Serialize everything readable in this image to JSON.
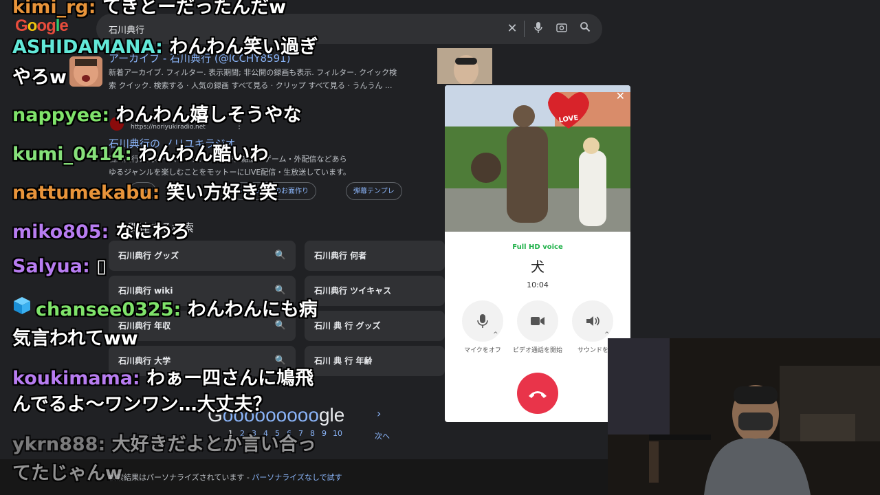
{
  "google": {
    "logo_letters": [
      "G",
      "o",
      "o",
      "g",
      "l",
      "e"
    ],
    "search_query": "石川典行",
    "result1": {
      "title": "アーカイブ - 石川典行 (@ICCHY8591)",
      "snippet_line1": "新着アーカイブ. フィルター. 表示期間; 非公開の録画も表示. フィルター. クイック検",
      "snippet_line2": "索 クイック. 検索する · 人気の録画 すべて見る · クリップ すべて見る · うんうん ..."
    },
    "result2": {
      "url": "https://noriyukiradio.net",
      "title": "石川典行の ノリユキラジオ",
      "snippet_line1": "石川典行公式ホームページ. ノリラジ。雑談・ゲーム・外配信などあら",
      "snippet_line2": "ゆるジャンルを楽しむことをモットーにLIVE配信・生放送しています。"
    },
    "chips": [
      "ishi",
      "ハロウィンのお面作り",
      "弾幕テンプレ"
    ],
    "related_heading": "関連する検索",
    "related": [
      "石川典行 グッズ",
      "石川典行 何者",
      "石川典行 wiki",
      "石川典行 ツイキャス",
      "石川典行 年収",
      "石川 典 行 グッズ",
      "石川典行 大学",
      "石川 典 行 年齢"
    ],
    "pagination_logo": {
      "prefix": "G",
      "repeat": "ooooooooo",
      "suffix": "gle"
    },
    "pages": [
      "1",
      "2",
      "3",
      "4",
      "5",
      "6",
      "7",
      "8",
      "9",
      "10"
    ],
    "next_label": "次へ",
    "footer_text": "検索結果はパーソナライズされています - ",
    "footer_link": "パーソナライズなしで試す"
  },
  "chat": [
    {
      "user": "kimi_rg",
      "sep": ": ",
      "msg": "てきとーだったんだw",
      "color": "orange"
    },
    {
      "user": "ASHIDAMANA",
      "sep": ": ",
      "msg": "わんわん笑い過ぎ",
      "color": "cyan"
    },
    {
      "user": "",
      "sep": "",
      "msg": "やろw",
      "color": "orange"
    },
    {
      "user": "nappyee",
      "sep": ": ",
      "msg": "わんわん嬉しそうやな",
      "color": "lgreen"
    },
    {
      "user": "kumi_0414",
      "sep": ": ",
      "msg": "わんわん酷いわ",
      "color": "green"
    },
    {
      "user": "nattumekabu",
      "sep": ": ",
      "msg": "笑い方好き笑",
      "color": "orange"
    },
    {
      "user": "miko805",
      "sep": ": ",
      "msg": "なにわろ",
      "color": "purple"
    },
    {
      "user": "Salyua",
      "sep": ": ",
      "msg": "▯",
      "color": "purple"
    },
    {
      "user": "chansee0325",
      "sep": ": ",
      "msg": "わんわんにも病",
      "color": "lgreen"
    },
    {
      "user": "",
      "sep": "",
      "msg": "気言われてww",
      "color": "lgreen"
    },
    {
      "user": "koukimama",
      "sep": ": ",
      "msg": "わぁー四さんに鳩飛",
      "color": "purple"
    },
    {
      "user": "",
      "sep": "",
      "msg": "んでるよ〜ワンワン…大丈夫？",
      "color": "purple"
    },
    {
      "user": "ykrn888",
      "sep": ": ",
      "msg": "大好きだよとか言い合っ",
      "color": "gray"
    },
    {
      "user": "",
      "sep": "",
      "msg": "てたじゃんw",
      "color": "gray"
    }
  ],
  "call": {
    "sticker_text": "LOVE",
    "hd_label": "Full HD voice",
    "contact": "犬",
    "duration": "10:04",
    "buttons": [
      {
        "icon": "microphone-icon",
        "glyph": "🎙",
        "label": "マイクをオフ"
      },
      {
        "icon": "video-camera-icon",
        "glyph": "■",
        "label": "ビデオ通話を開始"
      },
      {
        "icon": "speaker-icon",
        "glyph": "🔊",
        "label": "サウンドをオ"
      }
    ],
    "end_glyph": "☎"
  },
  "colors": {
    "orange": "#e8943a",
    "green": "#86e07a",
    "lgreen": "#7fe36a",
    "purple": "#b77cf0",
    "cyan": "#62e8d8",
    "gray": "#9a9a9a",
    "end_call": "#e9344a",
    "hd_voice": "#20b14a",
    "link": "#8ab4f8"
  }
}
